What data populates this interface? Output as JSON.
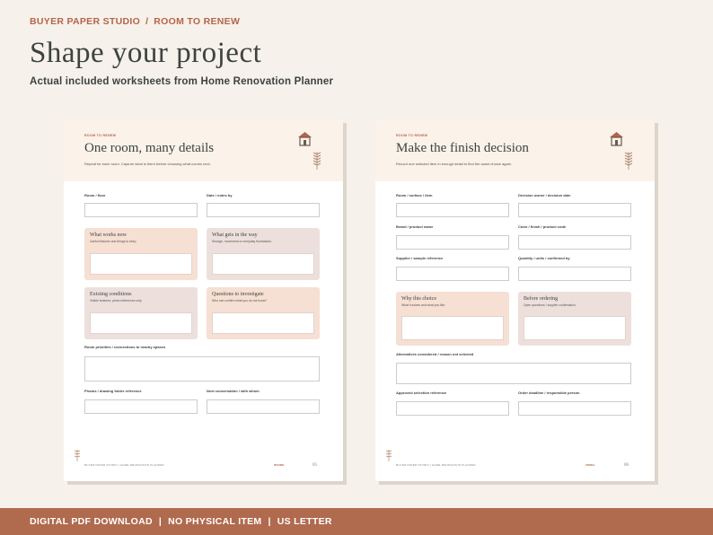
{
  "header": {
    "brand": "BUYER PAPER STUDIO",
    "separator": "/",
    "collection": "ROOM TO RENEW",
    "title": "Shape your project",
    "subtitle": "Actual included worksheets from Home Renovation Planner"
  },
  "left_sheet": {
    "kicker": "ROOM TO RENEW",
    "title": "One room, many details",
    "description": "Repeat for each room. Capture what is there before choosing what comes next.",
    "labels": {
      "room_floor": "Room / floor",
      "date_notes": "Date / notes by",
      "priorities": "Room priorities / connections to nearby spaces",
      "photos": "Photos / drawing folder reference",
      "next_conversation": "Next conversation / with whom"
    },
    "cards": {
      "works_now": {
        "title": "What works now",
        "sub": "Useful features and things to keep."
      },
      "in_the_way": {
        "title": "What gets in the way",
        "sub": "Storage, movement or everyday frustrations."
      },
      "existing": {
        "title": "Existing conditions",
        "sub": "Visible features; photo references only."
      },
      "questions": {
        "title": "Questions to investigate",
        "sub": "Who can confirm what you do not know?"
      }
    },
    "footer": {
      "left": "BUYER PAPER STUDIO  |  HOME RENOVATION PLANNER",
      "section": "ROOMS",
      "page": "05"
    }
  },
  "right_sheet": {
    "kicker": "ROOM TO RENEW",
    "title": "Make the finish decision",
    "description": "Record one selected item in enough detail to find the same choice again.",
    "labels": {
      "room_surface": "Room / surface / item",
      "decision_owner": "Decision owner / decision date",
      "brand": "Brand / product name",
      "color": "Color / finish / product code",
      "supplier": "Supplier / sample reference",
      "quantity": "Quantity / units / confirmed by",
      "alternatives": "Alternatives considered / reason not selected",
      "approved": "Approved selection reference",
      "order_deadline": "Order deadline / responsible person"
    },
    "cards": {
      "why": {
        "title": "Why this choice",
        "sub": "What it solves and what you like."
      },
      "before_ordering": {
        "title": "Before ordering",
        "sub": "Open questions / supplier confirmation."
      }
    },
    "footer": {
      "left": "BUYER PAPER STUDIO  |  HOME RENOVATION PLANNER",
      "section": "FINISH",
      "page": "06"
    }
  },
  "bottom_bar": {
    "item1": "DIGITAL PDF DOWNLOAD",
    "sep": "|",
    "item2": "NO PHYSICAL ITEM",
    "item3": "US LETTER"
  },
  "colors": {
    "accent": "#b5654a",
    "background": "#f6f1ea",
    "bar": "#b06a4e",
    "card_peach": "#f6dfd3",
    "card_mauve": "#ede0dc"
  },
  "icons": [
    "house-icon",
    "wheat-sprig-icon",
    "leaf-icon"
  ]
}
